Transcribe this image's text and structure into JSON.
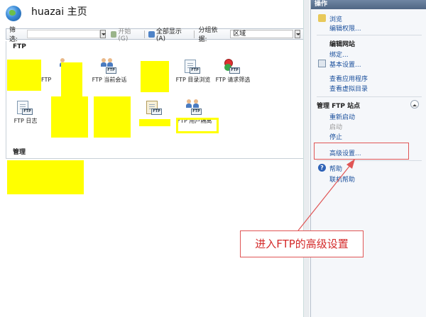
{
  "header": {
    "title": "huazai 主页"
  },
  "filter": {
    "label": "筛选:",
    "start_label": "开始(G)",
    "show_all_label": "全部显示(A)",
    "group_by_label": "分组依据:",
    "group_by_value": "区域"
  },
  "sections": {
    "ftp": "FTP",
    "manage": "管理"
  },
  "tiles": [
    {
      "label": ""
    },
    {
      "label": "FTP"
    },
    {
      "label": "FTP 当前会话"
    },
    {
      "label": ""
    },
    {
      "label": "FTP 目录浏览"
    },
    {
      "label": "FTP 请求筛选"
    },
    {
      "label": "FTP 日志"
    },
    {
      "label": ""
    },
    {
      "label": ""
    },
    {
      "label": ""
    },
    {
      "label": "FTP 用户隔离"
    }
  ],
  "actions": {
    "header": "操作",
    "browse": "浏览",
    "edit_permissions": "编辑权限...",
    "edit_site_group": "编辑网站",
    "bindings": "绑定...",
    "basic_settings": "基本设置...",
    "view_apps": "查看应用程序",
    "view_vdirs": "查看虚拟目录",
    "manage_ftp_group": "管理 FTP 站点",
    "restart": "重新启动",
    "start": "启动",
    "stop": "停止",
    "advanced_settings": "高级设置...",
    "help": "帮助",
    "online_help": "联机帮助"
  },
  "annotation": {
    "callout_text": "进入FTP的高级设置"
  },
  "colors": {
    "redact": "#ffff00",
    "annotation": "#e05555",
    "link": "#1a4f9c"
  }
}
